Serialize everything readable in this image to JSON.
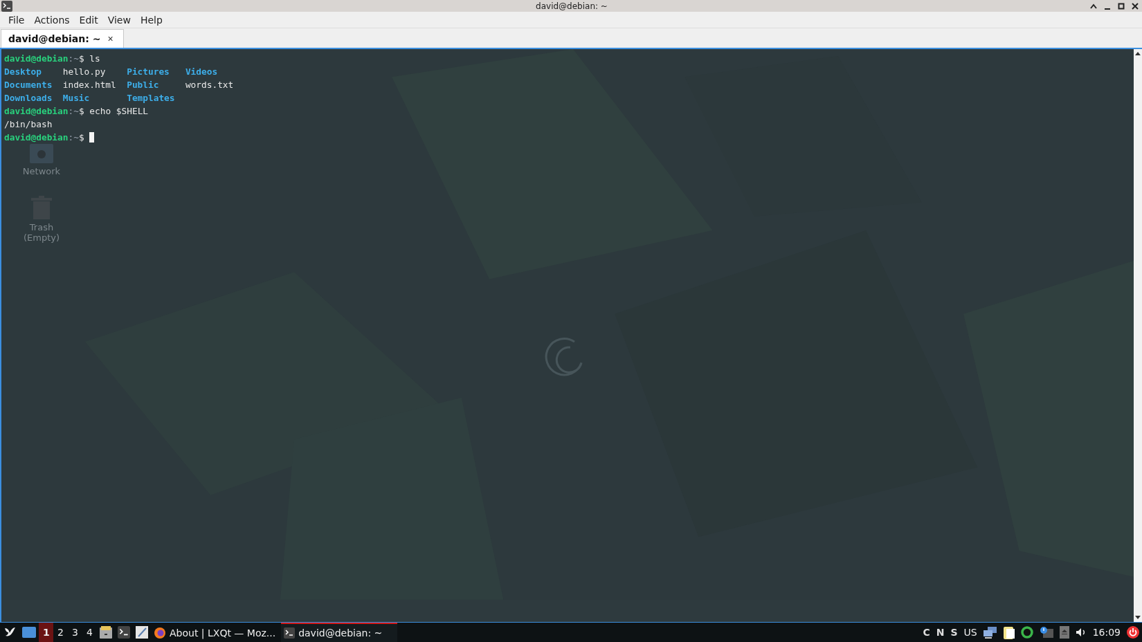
{
  "window": {
    "title": "david@debian: ~"
  },
  "menu": [
    "File",
    "Actions",
    "Edit",
    "View",
    "Help"
  ],
  "tabs": [
    {
      "label": "david@debian: ~",
      "close": "×",
      "selected": true
    }
  ],
  "terminal": {
    "lines": [
      {
        "kind": "prompt",
        "user": "david@debian",
        "path": ":~",
        "sign": "$",
        "command": " ls"
      },
      {
        "kind": "listing",
        "cells": [
          {
            "text": "Desktop",
            "kind": "dir"
          },
          {
            "text": "hello.py",
            "kind": "file"
          },
          {
            "text": "Pictures",
            "kind": "dir"
          },
          {
            "text": "Videos",
            "kind": "dir"
          }
        ]
      },
      {
        "kind": "listing",
        "cells": [
          {
            "text": "Documents",
            "kind": "dir"
          },
          {
            "text": "index.html",
            "kind": "file"
          },
          {
            "text": "Public",
            "kind": "dir"
          },
          {
            "text": "words.txt",
            "kind": "file"
          }
        ]
      },
      {
        "kind": "listing",
        "cells": [
          {
            "text": "Downloads",
            "kind": "dir"
          },
          {
            "text": "Music",
            "kind": "dir"
          },
          {
            "text": "Templates",
            "kind": "dir"
          }
        ]
      },
      {
        "kind": "prompt",
        "user": "david@debian",
        "path": ":~",
        "sign": "$",
        "command": " echo $SHELL"
      },
      {
        "kind": "output",
        "text": "/bin/bash"
      },
      {
        "kind": "prompt",
        "user": "david@debian",
        "path": ":~",
        "sign": "$",
        "cursor": true
      }
    ]
  },
  "desktop_icons": [
    {
      "label": "Network",
      "kind": "network"
    },
    {
      "label": "Trash\n(Empty)",
      "kind": "trash"
    }
  ],
  "taskbar": {
    "workspaces": [
      {
        "label": "1",
        "selected": true
      },
      {
        "label": "2",
        "selected": false
      },
      {
        "label": "3",
        "selected": false
      },
      {
        "label": "4",
        "selected": false
      }
    ],
    "tasks": [
      {
        "label": "About | LXQt — Moz...",
        "kind": "browser",
        "selected": false
      },
      {
        "label": "david@debian: ~",
        "kind": "terminal",
        "selected": true
      }
    ],
    "indicators": [
      "C",
      "N",
      "S"
    ],
    "layout": "US",
    "clock": "16:09"
  }
}
